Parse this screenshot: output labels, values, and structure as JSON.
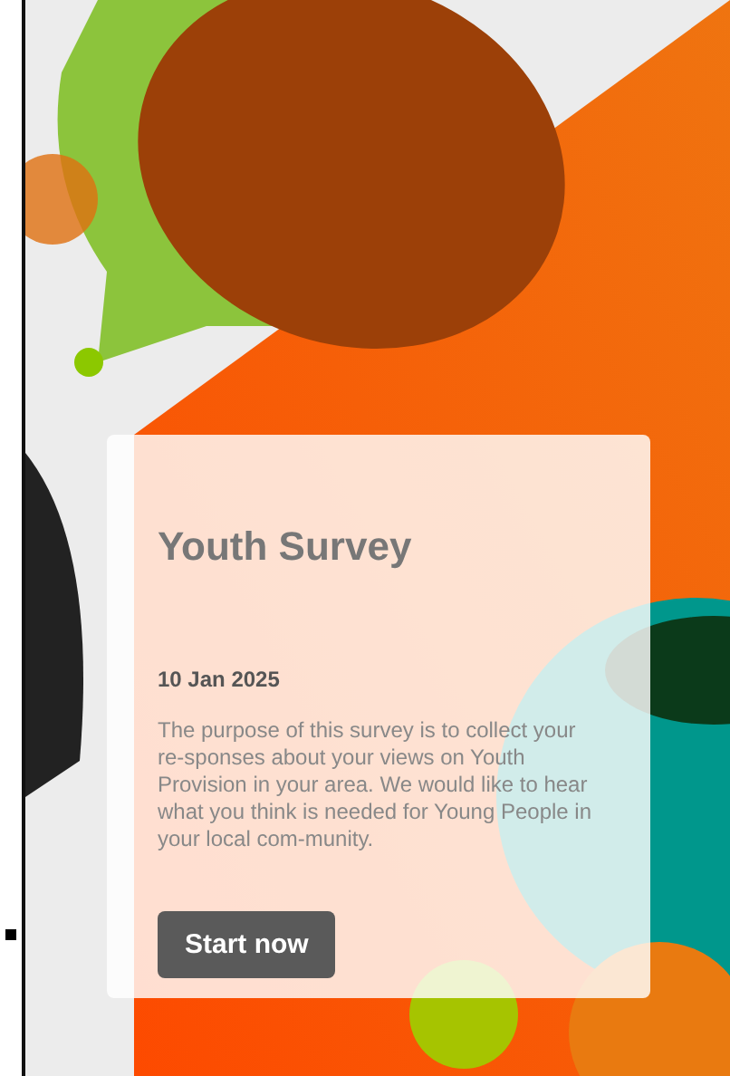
{
  "survey": {
    "title": "Youth Survey",
    "date": "10 Jan 2025",
    "description": "The purpose of this survey is to collect your re-sponses about your views on Youth Provision in your area. We would like to hear what you think is needed for Young People in your local com-munity.",
    "button": "Start now"
  }
}
